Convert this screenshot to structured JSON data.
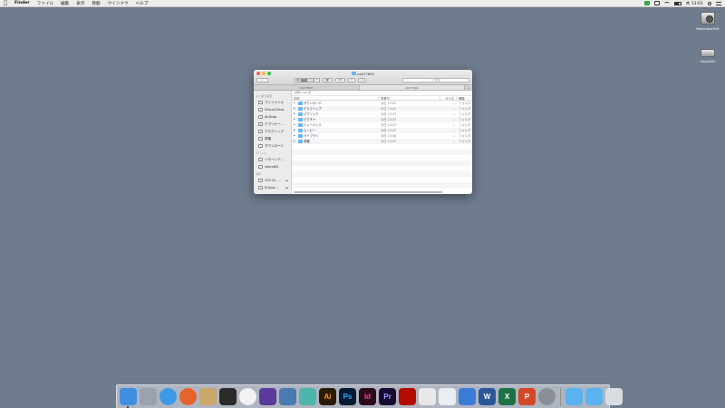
{
  "menubar": {
    "apple": "",
    "app_name": "Finder",
    "items": [
      "ファイル",
      "編集",
      "表示",
      "移動",
      "ウインドウ",
      "ヘルプ"
    ],
    "clock": "木 13:01"
  },
  "desktop": {
    "icons": [
      {
        "label": "MacintoshHD"
      },
      {
        "label": "UsersHD"
      }
    ]
  },
  "window": {
    "title": "cd477600",
    "search_placeholder": "検索",
    "tabs": [
      "cd477600",
      "cd477600"
    ],
    "tab_add": "+",
    "path": "共有フォルダ",
    "sidebar": {
      "favorites_header": "よく使う項目",
      "favorites": [
        "マイファイル",
        "iCloud Drive",
        "AirDrop",
        "アプリケー…",
        "デスクトップ",
        "書類",
        "ダウンロード"
      ],
      "devices_header": "デバイス",
      "devices": [
        "リモートデ…",
        "UsersHD"
      ],
      "shared_header": "共有",
      "shared": [
        "133.41.…",
        "N-Syst…"
      ]
    },
    "columns": {
      "name": "名前",
      "date": "変更日",
      "size": "サイズ",
      "kind": "種類"
    },
    "files": [
      {
        "name": "ダウンロード",
        "date": "今日 13:47",
        "size": "--",
        "kind": "フォルダ"
      },
      {
        "name": "デスクトップ",
        "date": "今日 13:47",
        "size": "--",
        "kind": "フォルダ"
      },
      {
        "name": "パブリック",
        "date": "今日 13:47",
        "size": "--",
        "kind": "フォルダ"
      },
      {
        "name": "ピクチャ",
        "date": "今日 13:47",
        "size": "--",
        "kind": "フォルダ"
      },
      {
        "name": "ミュージック",
        "date": "今日 13:47",
        "size": "--",
        "kind": "フォルダ"
      },
      {
        "name": "ムービー",
        "date": "今日 13:47",
        "size": "--",
        "kind": "フォルダ"
      },
      {
        "name": "ライブラリ",
        "date": "今日 13:48",
        "size": "--",
        "kind": "フォルダ"
      },
      {
        "name": "書類",
        "date": "今日 13:47",
        "size": "--",
        "kind": "フォルダ"
      }
    ]
  },
  "dock": {
    "apps": [
      {
        "name": "finder-icon",
        "bg": "#3f8ee0",
        "glyph": ""
      },
      {
        "name": "launchpad-icon",
        "bg": "#9aa3ad",
        "glyph": ""
      },
      {
        "name": "safari-icon",
        "bg": "#3d9ae8",
        "glyph": ""
      },
      {
        "name": "firefox-icon",
        "bg": "#e6632b",
        "glyph": ""
      },
      {
        "name": "preview-icon",
        "bg": "#c9a86a",
        "glyph": ""
      },
      {
        "name": "terminal-icon",
        "bg": "#2a2a2a",
        "glyph": ""
      },
      {
        "name": "photos-icon",
        "bg": "#f2f2f2",
        "glyph": ""
      },
      {
        "name": "imovie-icon",
        "bg": "#5a3a9a",
        "glyph": ""
      },
      {
        "name": "quicktime-icon",
        "bg": "#4a7ab0",
        "glyph": ""
      },
      {
        "name": "photo-app-icon",
        "bg": "#4db6ac",
        "glyph": ""
      },
      {
        "name": "illustrator-icon",
        "bg": "#2b1a04",
        "glyph": "Ai",
        "fg": "#f7a21b"
      },
      {
        "name": "photoshop-icon",
        "bg": "#061a33",
        "glyph": "Ps",
        "fg": "#31a8ff"
      },
      {
        "name": "indesign-icon",
        "bg": "#2c0a1a",
        "glyph": "Id",
        "fg": "#ff3d93"
      },
      {
        "name": "premiere-icon",
        "bg": "#1a0a33",
        "glyph": "Pr",
        "fg": "#9f9fff"
      },
      {
        "name": "acrobat-icon",
        "bg": "#b30b00",
        "glyph": ""
      },
      {
        "name": "textedit-icon",
        "bg": "#e8e8e8",
        "glyph": ""
      },
      {
        "name": "numbers-icon",
        "bg": "#e9eef2",
        "glyph": ""
      },
      {
        "name": "keynote-icon",
        "bg": "#3a7bd5",
        "glyph": ""
      },
      {
        "name": "word-icon",
        "bg": "#2b579a",
        "glyph": "W",
        "fg": "#ffffff"
      },
      {
        "name": "excel-icon",
        "bg": "#1e7145",
        "glyph": "X",
        "fg": "#ffffff"
      },
      {
        "name": "powerpoint-icon",
        "bg": "#d24726",
        "glyph": "P",
        "fg": "#ffffff"
      },
      {
        "name": "system-preferences-icon",
        "bg": "#8a8f96",
        "glyph": ""
      },
      {
        "name": "folder-applications-icon",
        "bg": "#5ab2ef",
        "glyph": ""
      },
      {
        "name": "folder-downloads-icon",
        "bg": "#5ab2ef",
        "glyph": ""
      },
      {
        "name": "trash-icon",
        "bg": "#d9dde2",
        "glyph": ""
      }
    ]
  }
}
